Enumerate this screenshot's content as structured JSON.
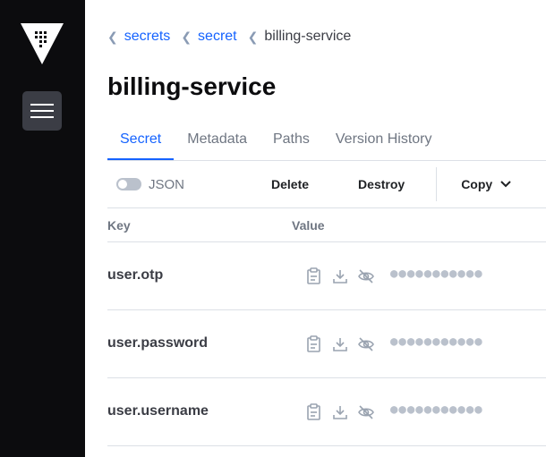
{
  "breadcrumb": [
    {
      "label": "secrets"
    },
    {
      "label": "secret"
    }
  ],
  "breadcrumb_current": "billing-service",
  "page_title": "billing-service",
  "tabs": [
    {
      "label": "Secret",
      "active": true
    },
    {
      "label": "Metadata",
      "active": false
    },
    {
      "label": "Paths",
      "active": false
    },
    {
      "label": "Version History",
      "active": false
    }
  ],
  "toolbar": {
    "json_label": "JSON",
    "json_enabled": false,
    "delete_label": "Delete",
    "destroy_label": "Destroy",
    "copy_label": "Copy"
  },
  "table": {
    "headers": {
      "key": "Key",
      "value": "Value"
    },
    "rows": [
      {
        "key": "user.otp",
        "masked": "●●●●●●●●●●●"
      },
      {
        "key": "user.password",
        "masked": "●●●●●●●●●●●"
      },
      {
        "key": "user.username",
        "masked": "●●●●●●●●●●●"
      }
    ],
    "row_icons": [
      "clipboard-icon",
      "download-icon",
      "eye-off-icon"
    ]
  },
  "colors": {
    "sidebar": "#0c0c0e",
    "accent": "#1563ff",
    "menu_button": "#3b3d45"
  }
}
